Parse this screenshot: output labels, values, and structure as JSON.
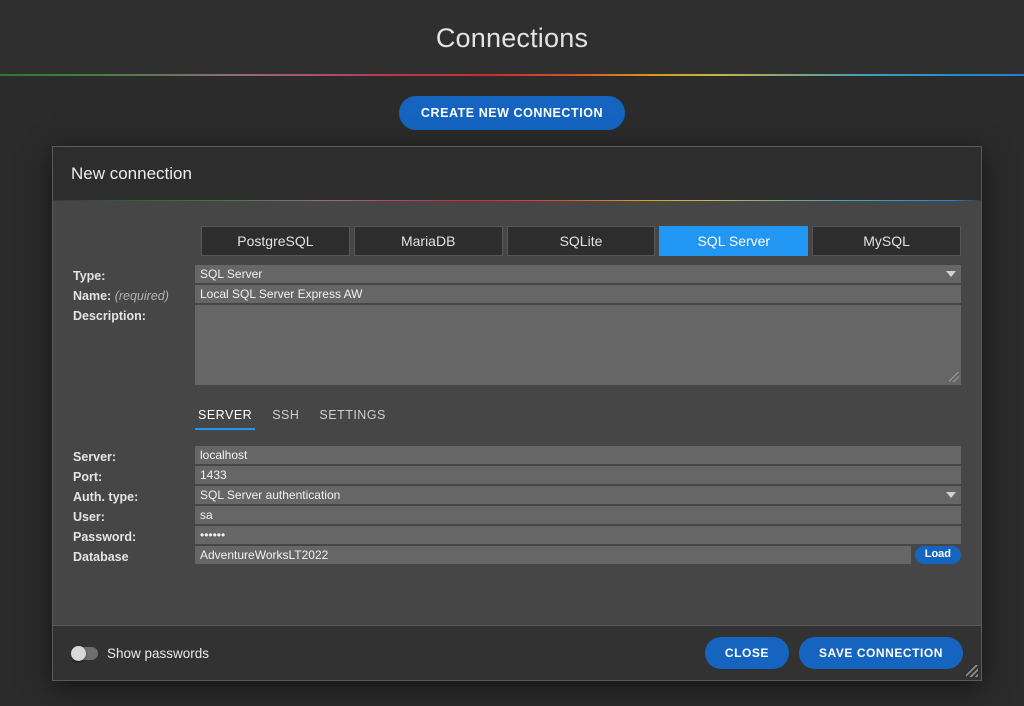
{
  "page": {
    "title": "Connections",
    "create_button": "CREATE NEW CONNECTION"
  },
  "dialog": {
    "title": "New connection",
    "db_types": [
      {
        "label": "PostgreSQL",
        "active": false
      },
      {
        "label": "MariaDB",
        "active": false
      },
      {
        "label": "SQLite",
        "active": false
      },
      {
        "label": "SQL Server",
        "active": true
      },
      {
        "label": "MySQL",
        "active": false
      }
    ],
    "fields": {
      "type_label": "Type:",
      "type_value": "SQL Server",
      "name_label": "Name:",
      "name_required": "(required)",
      "name_value": "Local SQL Server Express AW",
      "description_label": "Description:",
      "description_value": ""
    },
    "subtabs": [
      {
        "label": "SERVER",
        "active": true
      },
      {
        "label": "SSH",
        "active": false
      },
      {
        "label": "SETTINGS",
        "active": false
      }
    ],
    "server": {
      "server_label": "Server:",
      "server_value": "localhost",
      "port_label": "Port:",
      "port_value": "1433",
      "auth_label": "Auth. type:",
      "auth_value": "SQL Server authentication",
      "user_label": "User:",
      "user_value": "sa",
      "password_label": "Password:",
      "password_value": "••••••",
      "database_label": "Database",
      "database_value": "AdventureWorksLT2022",
      "load_button": "Load"
    },
    "footer": {
      "show_passwords_label": "Show passwords",
      "show_passwords_on": false,
      "close_button": "CLOSE",
      "save_button": "SAVE CONNECTION"
    }
  },
  "colors": {
    "accent_blue": "#2196f3",
    "button_blue": "#1565c0",
    "page_bg": "#2b2b2b",
    "dialog_bg": "#464646",
    "input_bg": "#666666"
  }
}
